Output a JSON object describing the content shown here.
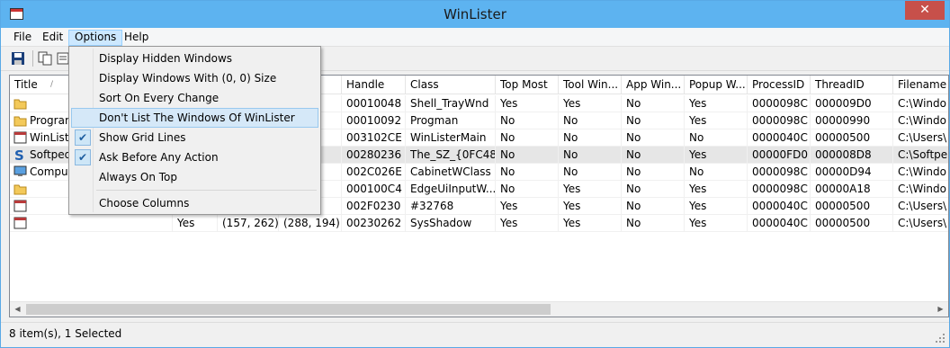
{
  "window": {
    "title": "WinLister"
  },
  "menu": [
    "File",
    "Edit",
    "Options",
    "Help"
  ],
  "columns": [
    "Title",
    "",
    "",
    "",
    "Handle",
    "Class",
    "Top Most",
    "Tool Win...",
    "App Win...",
    "Popup W...",
    "ProcessID",
    "ThreadID",
    "Filename"
  ],
  "rows": [
    {
      "title": "",
      "c1": "",
      "c2": "",
      "c3": "0)",
      "handle": "00010048",
      "class": "Shell_TrayWnd",
      "topmost": "Yes",
      "tool": "Yes",
      "app": "No",
      "popup": "Yes",
      "pid": "0000098C",
      "tid": "000009D0",
      "file": "C:\\Windo",
      "icon": "folder-icon"
    },
    {
      "title": "Program",
      "c1": "",
      "c2": "",
      "c3": "96)",
      "handle": "00010092",
      "class": "Progman",
      "topmost": "No",
      "tool": "No",
      "app": "No",
      "popup": "Yes",
      "pid": "0000098C",
      "tid": "00000990",
      "file": "C:\\Windo",
      "icon": "folder-icon"
    },
    {
      "title": "WinListe",
      "c1": "",
      "c2": "",
      "c3": "37)",
      "handle": "003102CE",
      "class": "WinListerMain",
      "topmost": "No",
      "tool": "No",
      "app": "No",
      "popup": "No",
      "pid": "0000040C",
      "tid": "00000500",
      "file": "C:\\Users\\",
      "icon": "window-icon"
    },
    {
      "title": "Softpedi",
      "c1": "",
      "c2": "",
      "c3": "96)",
      "handle": "00280236",
      "class": "The_SZ_{0FC48...",
      "topmost": "No",
      "tool": "No",
      "app": "No",
      "popup": "Yes",
      "pid": "00000FD0",
      "tid": "000008D8",
      "file": "C:\\Softpe",
      "icon": "softpedia-icon",
      "selected": true
    },
    {
      "title": "Comput",
      "c1": "",
      "c2": "",
      "c3": "",
      "handle": "002C026E",
      "class": "CabinetWClass",
      "topmost": "No",
      "tool": "No",
      "app": "No",
      "popup": "No",
      "pid": "0000098C",
      "tid": "00000D94",
      "file": "C:\\Windo",
      "icon": "computer-icon"
    },
    {
      "title": "",
      "c1": "",
      "c2": "",
      "c3": "0)",
      "handle": "000100C4",
      "class": "EdgeUiInputW...",
      "topmost": "No",
      "tool": "Yes",
      "app": "No",
      "popup": "Yes",
      "pid": "0000098C",
      "tid": "00000A18",
      "file": "C:\\Windo",
      "icon": "folder-icon"
    },
    {
      "title": "",
      "c1": "",
      "c2": "",
      "c3": "9)",
      "handle": "002F0230",
      "class": "#32768",
      "topmost": "Yes",
      "tool": "Yes",
      "app": "No",
      "popup": "Yes",
      "pid": "0000040C",
      "tid": "00000500",
      "file": "C:\\Users\\",
      "icon": "window-icon"
    },
    {
      "title": "",
      "c1": "Yes",
      "c2": "(157, 262)",
      "c3": "(288, 194)",
      "handle": "00230262",
      "class": "SysShadow",
      "topmost": "Yes",
      "tool": "Yes",
      "app": "No",
      "popup": "Yes",
      "pid": "0000040C",
      "tid": "00000500",
      "file": "C:\\Users\\",
      "icon": "window-icon"
    }
  ],
  "options_menu": {
    "items": [
      {
        "label": "Display Hidden Windows",
        "checked": false
      },
      {
        "label": "Display Windows With (0, 0) Size",
        "checked": false
      },
      {
        "label": "Sort On Every Change",
        "checked": false
      },
      {
        "label": "Don't List The Windows Of WinLister",
        "checked": false,
        "hover": true
      },
      {
        "label": "Show Grid Lines",
        "checked": true
      },
      {
        "label": "Ask Before Any Action",
        "checked": true
      },
      {
        "label": "Always On Top",
        "checked": false
      },
      {
        "label": "Choose Columns",
        "checked": false
      }
    ],
    "check_glyph": "✔"
  },
  "status": {
    "text": "8 item(s), 1 Selected"
  },
  "close_glyph": "✕"
}
